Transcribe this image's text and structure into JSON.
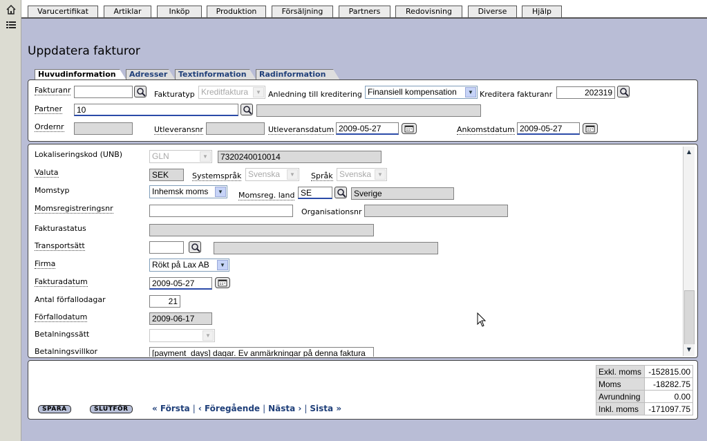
{
  "menu": [
    "Varucertifikat",
    "Artiklar",
    "Inköp",
    "Produktion",
    "Försäljning",
    "Partners",
    "Redovisning",
    "Diverse",
    "Hjälp"
  ],
  "page_title": "Uppdatera fakturor",
  "tabs": [
    "Huvudinformation",
    "Adresser",
    "Textinformation",
    "Radinformation"
  ],
  "header": {
    "fakturanr_label": "Fakturanr",
    "fakturanr_value": "",
    "fakturatyp_label": "Fakturatyp",
    "fakturatyp_value": "Kreditfaktura",
    "anledning_label": "Anledning till kreditering",
    "anledning_value": "Finansiell kompensation",
    "kreditera_label": "Kreditera fakturanr",
    "kreditera_value": "202319",
    "partner_label": "Partner",
    "partner_value": "10",
    "partner_name": "",
    "ordernr_label": "Ordernr",
    "ordernr_value": "",
    "utleveransnr_label": "Utleveransnr",
    "utleveransnr_value": "",
    "utleveransdatum_label": "Utleveransdatum",
    "utleveransdatum_value": "2009-05-27",
    "ankomstdatum_label": "Ankomstdatum",
    "ankomstdatum_value": "2009-05-27"
  },
  "details": {
    "lokalisering_label": "Lokaliseringskod (UNB)",
    "lokalisering_type": "GLN",
    "lokalisering_value": "7320240010014",
    "valuta_label": "Valuta",
    "valuta_value": "SEK",
    "systemsprak_label": "Systemspråk",
    "systemsprak_value": "Svenska",
    "sprak_label": "Språk",
    "sprak_value": "Svenska",
    "momstyp_label": "Momstyp",
    "momstyp_value": "Inhemsk moms",
    "momsreg_land_label": "Momsreg. land",
    "momsreg_land_code": "SE",
    "momsreg_land_name": "Sverige",
    "momsregnr_label": "Momsregistreringsnr",
    "momsregnr_value": "",
    "orgnr_label": "Organisationsnr",
    "orgnr_value": "",
    "fakturastatus_label": "Fakturastatus",
    "fakturastatus_value": "",
    "transportsatt_label": "Transportsätt",
    "transportsatt_code": "",
    "transportsatt_name": "",
    "firma_label": "Firma",
    "firma_value": "Rökt på Lax AB",
    "fakturadatum_label": "Fakturadatum",
    "fakturadatum_value": "2009-05-27",
    "forfallodagar_label": "Antal förfallodagar",
    "forfallodagar_value": "21",
    "forfallodatum_label": "Förfallodatum",
    "forfallodatum_value": "2009-06-17",
    "betalningssatt_label": "Betalningssätt",
    "betalningssatt_value": "",
    "betalningsvillkor_label": "Betalningsvillkor",
    "betalningsvillkor_value": "[payment_days] dagar. Ev anmärkningar på denna faktura"
  },
  "actions": {
    "save": "SPARA",
    "finish": "SLUTFÖR"
  },
  "nav": {
    "first": "« Första",
    "prev": "‹ Föregående",
    "next": "Nästa ›",
    "last": "Sista »"
  },
  "totals": [
    {
      "label": "Exkl. moms",
      "value": "-152815.00"
    },
    {
      "label": "Moms",
      "value": "-18282.75"
    },
    {
      "label": "Avrundning",
      "value": "0.00"
    },
    {
      "label": "Inkl. moms",
      "value": "-171097.75"
    }
  ]
}
